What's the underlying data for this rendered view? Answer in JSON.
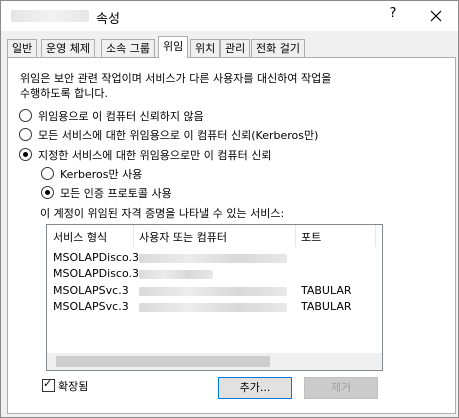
{
  "window": {
    "title": "속성",
    "help_glyph": "?",
    "close_glyph": "✕"
  },
  "tabs": [
    {
      "label": "일반"
    },
    {
      "label": "운영 체제"
    },
    {
      "label": "소속 그룹"
    },
    {
      "label": "위임"
    },
    {
      "label": "위치"
    },
    {
      "label": "관리"
    },
    {
      "label": "전화 걸기"
    }
  ],
  "active_tab": "위임",
  "description": [
    "위임은 보안 관련 작업이며 서비스가 다른 사용자를 대신하여 작업을",
    "수행하도록 합니다."
  ],
  "options": {
    "no_trust": "위임용으로 이 컴퓨터 신뢰하지 않음",
    "trust_any_kerberos": "모든 서비스에 대한 위임용으로 이 컴퓨터 신뢰(Kerberos만)",
    "trust_specified": "지정한 서비스에 대한 위임용으로만 이 컴퓨터 신뢰",
    "kerberos_only": "Kerberos만 사용",
    "any_protocol": "모든 인증 프로토콜 사용"
  },
  "services_label": "이 계정이 위임된 자격 증명을 나타낼 수 있는 서비스:",
  "list": {
    "headers": {
      "service_type": "서비스 형식",
      "user_or_computer": "사용자 또는 컴퓨터",
      "port": "포트"
    },
    "rows": [
      {
        "service_type": "MSOLAPDisco.3",
        "port": ""
      },
      {
        "service_type": "MSOLAPDisco.3",
        "port": ""
      },
      {
        "service_type": "MSOLAPSvc.3",
        "port": "TABULAR"
      },
      {
        "service_type": "MSOLAPSvc.3",
        "port": "TABULAR"
      }
    ]
  },
  "expanded": {
    "label": "확장됨",
    "checked": true
  },
  "buttons": {
    "add": "추가...",
    "remove": "제거"
  }
}
